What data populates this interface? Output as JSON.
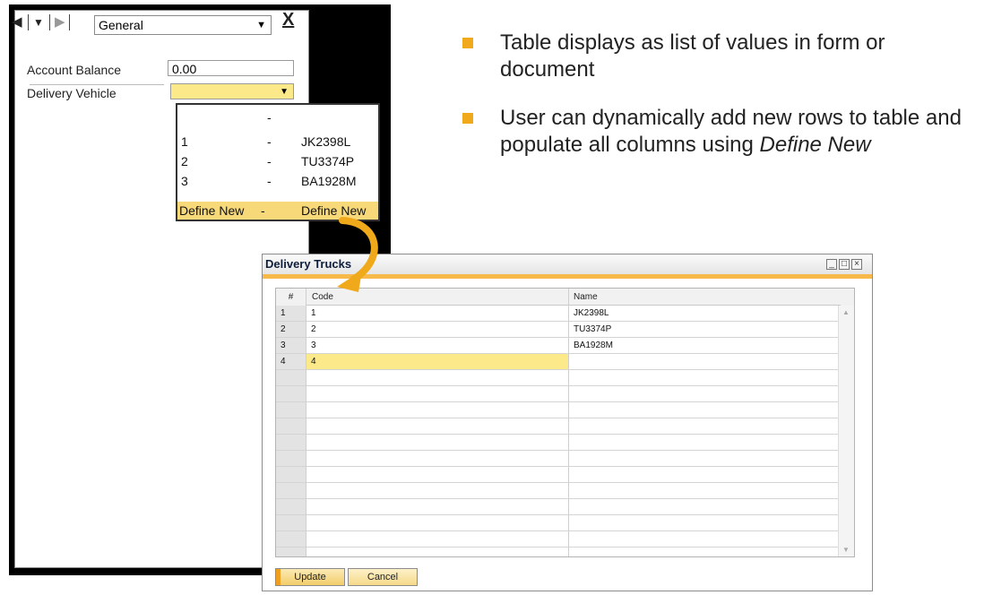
{
  "form": {
    "nav": {
      "prev": "◀",
      "down": "▼",
      "next": "▶"
    },
    "section": "General",
    "close": "X",
    "account_balance": {
      "label": "Account Balance",
      "value": "0.00"
    },
    "delivery_vehicle": {
      "label": "Delivery Vehicle",
      "value": ""
    },
    "dropdown": [
      {
        "code": "",
        "sep": "-",
        "name": ""
      },
      {
        "code": "1",
        "sep": "-",
        "name": "JK2398L"
      },
      {
        "code": "2",
        "sep": "-",
        "name": "TU3374P"
      },
      {
        "code": "3",
        "sep": "-",
        "name": "BA1928M"
      },
      {
        "code": "Define New",
        "sep": "-",
        "name": "Define New"
      }
    ]
  },
  "bullets": [
    {
      "text": "Table displays as list of values in form or document"
    },
    {
      "text": "User can dynamically add new rows to table and populate all columns using ",
      "em": "Define New"
    }
  ],
  "window": {
    "title": "Delivery Trucks",
    "columns": {
      "num": "#",
      "code": "Code",
      "name": "Name"
    },
    "rows": [
      {
        "num": "1",
        "code": "1",
        "name": "JK2398L"
      },
      {
        "num": "2",
        "code": "2",
        "name": "TU3374P"
      },
      {
        "num": "3",
        "code": "3",
        "name": "BA1928M"
      },
      {
        "num": "4",
        "code": "4",
        "name": ""
      }
    ],
    "buttons": {
      "update": "Update",
      "cancel": "Cancel"
    }
  },
  "colors": {
    "accent": "#f0a91b",
    "highlight": "#fbe98a",
    "title_text": "#0d1d3b"
  }
}
